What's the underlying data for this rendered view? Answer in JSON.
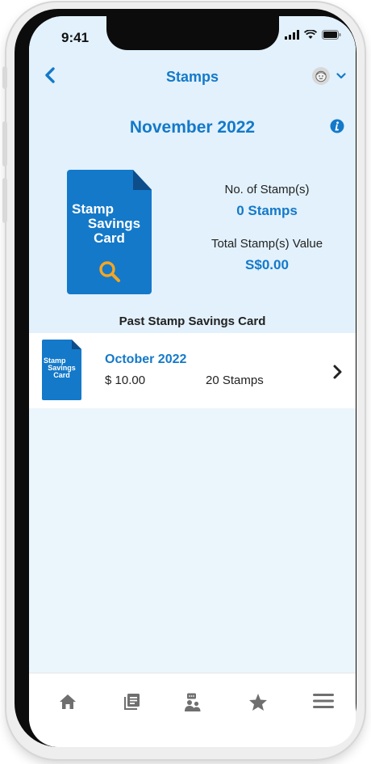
{
  "status_bar": {
    "time": "9:41"
  },
  "header": {
    "title": "Stamps"
  },
  "summary": {
    "month": "November 2022",
    "card_text": [
      "Stamp",
      "Savings",
      "Card"
    ],
    "stamp_count_label": "No. of Stamp(s)",
    "stamp_count_value": "0 Stamps",
    "total_value_label": "Total Stamp(s) Value",
    "total_value_value": "S$0.00",
    "past_section_label": "Past Stamp Savings Card"
  },
  "past_cards": [
    {
      "card_text": [
        "Stamp",
        "Savings",
        "Card"
      ],
      "month": "October 2022",
      "amount": "$ 10.00",
      "stamps": "20 Stamps"
    }
  ],
  "bottom_nav": {
    "items": [
      "home-icon",
      "news-icon",
      "community-chat-icon",
      "favorites-icon",
      "menu-icon"
    ]
  },
  "colors": {
    "accent": "#1479c9",
    "card_fold": "#0d4d8a",
    "search_icon": "#f5a623",
    "background": "#ebf5fc",
    "nav_icon": "#6f6f6f"
  }
}
